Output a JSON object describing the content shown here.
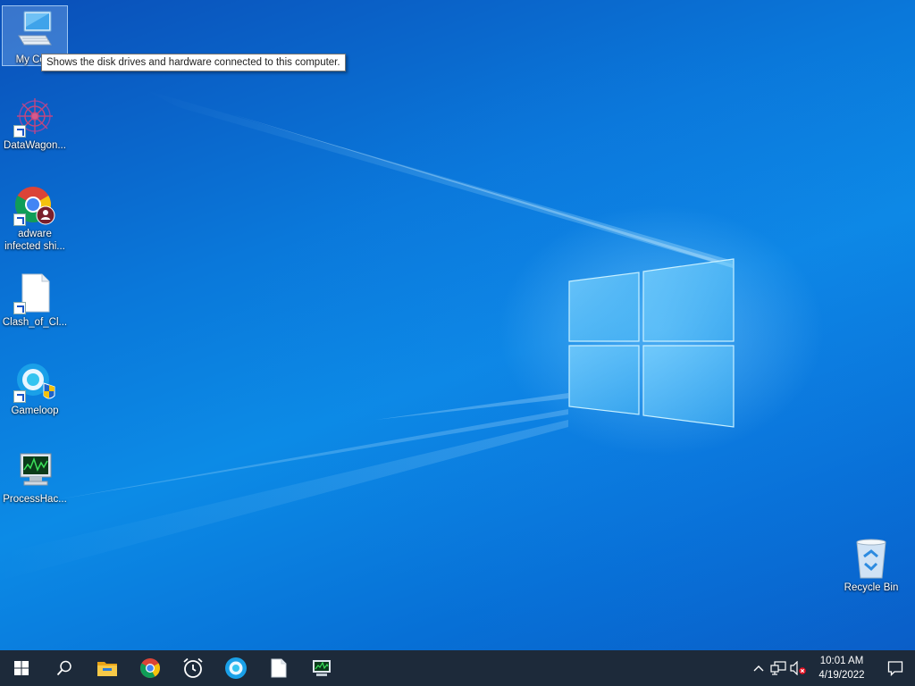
{
  "desktop": {
    "icons": [
      {
        "label": "My Com",
        "icon": "computer-icon"
      },
      {
        "label": "DataWagon...",
        "icon": "datawagon-icon"
      },
      {
        "label": "adware infected shi...",
        "icon": "chrome-profile-icon"
      },
      {
        "label": "Clash_of_Cl...",
        "icon": "blank-file-icon"
      },
      {
        "label": "Gameloop",
        "icon": "gameloop-icon"
      },
      {
        "label": "ProcessHac...",
        "icon": "processhacker-icon"
      }
    ],
    "recycle_bin": {
      "label": "Recycle Bin",
      "icon": "recycle-bin-icon"
    },
    "tooltip": "Shows the disk drives and hardware connected to this computer."
  },
  "taskbar": {
    "items": [
      "start-icon",
      "search-icon",
      "file-explorer-icon",
      "chrome-icon",
      "alarm-clock-icon",
      "gameloop-icon",
      "blank-file-icon",
      "processhacker-icon"
    ],
    "tray": {
      "icons": [
        "chevron-up-icon",
        "network-icon",
        "volume-muted-icon"
      ],
      "time": "10:01 AM",
      "date": "4/19/2022"
    }
  },
  "colors": {
    "taskbar": "#1d2a3a",
    "desktop_accent": "#0c8be6"
  }
}
